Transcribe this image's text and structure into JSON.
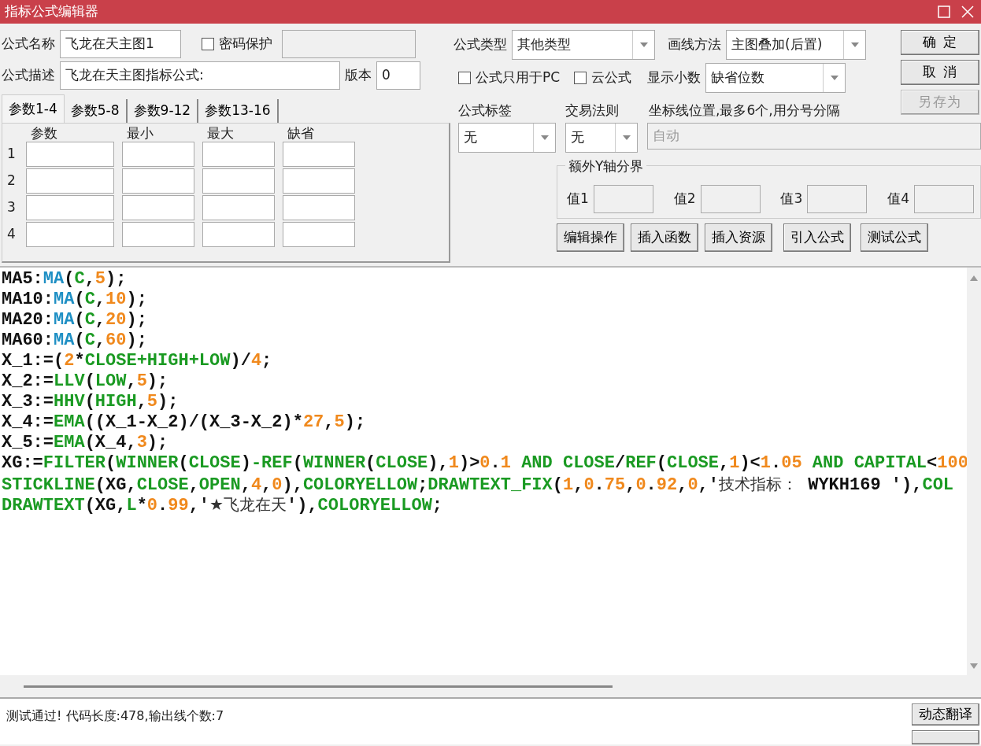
{
  "window": {
    "title": "指标公式编辑器"
  },
  "name_field": {
    "label": "公式名称",
    "value": "飞龙在天主图1"
  },
  "password": {
    "label": "密码保护",
    "checked": false
  },
  "description": {
    "label": "公式描述",
    "value": "飞龙在天主图指标公式:"
  },
  "version": {
    "label": "版本",
    "value": "0"
  },
  "param_tabs": [
    {
      "label": "参数1-4",
      "selected": true
    },
    {
      "label": "参数5-8",
      "selected": false
    },
    {
      "label": "参数9-12",
      "selected": false
    },
    {
      "label": "参数13-16",
      "selected": false
    }
  ],
  "param_columns": [
    "参数",
    "最小",
    "最大",
    "缺省"
  ],
  "param_rows": [
    "1",
    "2",
    "3",
    "4"
  ],
  "formula_type": {
    "label": "公式类型",
    "value": "其他类型"
  },
  "draw_method": {
    "label": "画线方法",
    "value": "主图叠加(后置)"
  },
  "pc_only": {
    "label": "公式只用于PC",
    "checked": false
  },
  "cloud": {
    "label": "云公式",
    "checked": false
  },
  "decimals": {
    "label": "显示小数",
    "value": "缺省位数"
  },
  "action_buttons": [
    {
      "label": "确 定",
      "disabled": false
    },
    {
      "label": "取 消",
      "disabled": false
    },
    {
      "label": "另存为",
      "disabled": true
    }
  ],
  "formula_tag": {
    "label": "公式标签",
    "value": "无"
  },
  "trade_rule": {
    "label": "交易法则",
    "value": "无"
  },
  "axis_lines": {
    "label": "坐标线位置,最多6个,用分号分隔",
    "placeholder": "自动"
  },
  "y_axis": {
    "title": "额外Y轴分界",
    "fields": [
      "值1",
      "值2",
      "值3",
      "值4"
    ]
  },
  "tool_buttons": [
    "编辑操作",
    "插入函数",
    "插入资源",
    "引入公式",
    "测试公式"
  ],
  "code_lines": [
    [
      {
        "kind": "plain",
        "text": "MA5:"
      },
      {
        "kind": "builtin",
        "text": "MA"
      },
      {
        "kind": "plain",
        "text": "("
      },
      {
        "kind": "keyword",
        "text": "C"
      },
      {
        "kind": "plain",
        "text": ","
      },
      {
        "kind": "number",
        "text": "5"
      },
      {
        "kind": "plain",
        "text": ");"
      }
    ],
    [
      {
        "kind": "plain",
        "text": "MA10:"
      },
      {
        "kind": "builtin",
        "text": "MA"
      },
      {
        "kind": "plain",
        "text": "("
      },
      {
        "kind": "keyword",
        "text": "C"
      },
      {
        "kind": "plain",
        "text": ","
      },
      {
        "kind": "number",
        "text": "10"
      },
      {
        "kind": "plain",
        "text": ");"
      }
    ],
    [
      {
        "kind": "plain",
        "text": "MA20:"
      },
      {
        "kind": "builtin",
        "text": "MA"
      },
      {
        "kind": "plain",
        "text": "("
      },
      {
        "kind": "keyword",
        "text": "C"
      },
      {
        "kind": "plain",
        "text": ","
      },
      {
        "kind": "number",
        "text": "20"
      },
      {
        "kind": "plain",
        "text": ");"
      }
    ],
    [
      {
        "kind": "plain",
        "text": "MA60:"
      },
      {
        "kind": "builtin",
        "text": "MA"
      },
      {
        "kind": "plain",
        "text": "("
      },
      {
        "kind": "keyword",
        "text": "C"
      },
      {
        "kind": "plain",
        "text": ","
      },
      {
        "kind": "number",
        "text": "60"
      },
      {
        "kind": "plain",
        "text": ");"
      }
    ],
    [
      {
        "kind": "plain",
        "text": "X_1:=("
      },
      {
        "kind": "number",
        "text": "2"
      },
      {
        "kind": "plain",
        "text": "*"
      },
      {
        "kind": "keyword",
        "text": "CLOSE+HIGH+LOW"
      },
      {
        "kind": "plain",
        "text": ")/"
      },
      {
        "kind": "number",
        "text": "4"
      },
      {
        "kind": "plain",
        "text": ";"
      }
    ],
    [
      {
        "kind": "plain",
        "text": "X_2:="
      },
      {
        "kind": "keyword",
        "text": "LLV"
      },
      {
        "kind": "plain",
        "text": "("
      },
      {
        "kind": "keyword",
        "text": "LOW"
      },
      {
        "kind": "plain",
        "text": ","
      },
      {
        "kind": "number",
        "text": "5"
      },
      {
        "kind": "plain",
        "text": ");"
      }
    ],
    [
      {
        "kind": "plain",
        "text": "X_3:="
      },
      {
        "kind": "keyword",
        "text": "HHV"
      },
      {
        "kind": "plain",
        "text": "("
      },
      {
        "kind": "keyword",
        "text": "HIGH"
      },
      {
        "kind": "plain",
        "text": ","
      },
      {
        "kind": "number",
        "text": "5"
      },
      {
        "kind": "plain",
        "text": ");"
      }
    ],
    [
      {
        "kind": "plain",
        "text": "X_4:="
      },
      {
        "kind": "keyword",
        "text": "EMA"
      },
      {
        "kind": "plain",
        "text": "((X_1-X_2)/(X_3-X_2)*"
      },
      {
        "kind": "number",
        "text": "27"
      },
      {
        "kind": "plain",
        "text": ","
      },
      {
        "kind": "number",
        "text": "5"
      },
      {
        "kind": "plain",
        "text": ");"
      }
    ],
    [
      {
        "kind": "plain",
        "text": "X_5:="
      },
      {
        "kind": "keyword",
        "text": "EMA"
      },
      {
        "kind": "plain",
        "text": "(X_4,"
      },
      {
        "kind": "number",
        "text": "3"
      },
      {
        "kind": "plain",
        "text": ");"
      }
    ],
    [
      {
        "kind": "plain",
        "text": "XG:="
      },
      {
        "kind": "keyword",
        "text": "FILTER"
      },
      {
        "kind": "plain",
        "text": "("
      },
      {
        "kind": "keyword",
        "text": "WINNER"
      },
      {
        "kind": "plain",
        "text": "("
      },
      {
        "kind": "keyword",
        "text": "CLOSE"
      },
      {
        "kind": "plain",
        "text": ")"
      },
      {
        "kind": "keyword",
        "text": "-REF"
      },
      {
        "kind": "plain",
        "text": "("
      },
      {
        "kind": "keyword",
        "text": "WINNER"
      },
      {
        "kind": "plain",
        "text": "("
      },
      {
        "kind": "keyword",
        "text": "CLOSE"
      },
      {
        "kind": "plain",
        "text": "),"
      },
      {
        "kind": "number",
        "text": "1"
      },
      {
        "kind": "plain",
        "text": ")>"
      },
      {
        "kind": "number",
        "text": "0"
      },
      {
        "kind": "plain",
        "text": "."
      },
      {
        "kind": "number",
        "text": "1"
      },
      {
        "kind": "keyword",
        "text": " AND CLOSE"
      },
      {
        "kind": "plain",
        "text": "/"
      },
      {
        "kind": "keyword",
        "text": "REF"
      },
      {
        "kind": "plain",
        "text": "("
      },
      {
        "kind": "keyword",
        "text": "CLOSE"
      },
      {
        "kind": "plain",
        "text": ","
      },
      {
        "kind": "number",
        "text": "1"
      },
      {
        "kind": "plain",
        "text": ")<"
      },
      {
        "kind": "number",
        "text": "1"
      },
      {
        "kind": "plain",
        "text": "."
      },
      {
        "kind": "number",
        "text": "05"
      },
      {
        "kind": "keyword",
        "text": " AND CAPITAL"
      },
      {
        "kind": "plain",
        "text": "<"
      },
      {
        "kind": "number",
        "text": "100"
      }
    ],
    [
      {
        "kind": "keyword",
        "text": "STICKLINE"
      },
      {
        "kind": "plain",
        "text": "(XG,"
      },
      {
        "kind": "keyword",
        "text": "CLOSE"
      },
      {
        "kind": "plain",
        "text": ","
      },
      {
        "kind": "keyword",
        "text": "OPEN"
      },
      {
        "kind": "plain",
        "text": ","
      },
      {
        "kind": "number",
        "text": "4"
      },
      {
        "kind": "plain",
        "text": ","
      },
      {
        "kind": "number",
        "text": "0"
      },
      {
        "kind": "plain",
        "text": "),"
      },
      {
        "kind": "keyword",
        "text": "COLORYELLOW"
      },
      {
        "kind": "plain",
        "text": ";"
      },
      {
        "kind": "keyword",
        "text": "DRAWTEXT_FIX"
      },
      {
        "kind": "plain",
        "text": "("
      },
      {
        "kind": "number",
        "text": "1"
      },
      {
        "kind": "plain",
        "text": ","
      },
      {
        "kind": "number",
        "text": "0"
      },
      {
        "kind": "plain",
        "text": "."
      },
      {
        "kind": "number",
        "text": "75"
      },
      {
        "kind": "plain",
        "text": ","
      },
      {
        "kind": "number",
        "text": "0"
      },
      {
        "kind": "plain",
        "text": "."
      },
      {
        "kind": "number",
        "text": "92"
      },
      {
        "kind": "plain",
        "text": ","
      },
      {
        "kind": "number",
        "text": "0"
      },
      {
        "kind": "plain",
        "text": ",'"
      },
      {
        "kind": "text",
        "text": "技术指标："
      },
      {
        "kind": "plain",
        "text": " WYKH169 '),"
      },
      {
        "kind": "keyword",
        "text": "COL"
      }
    ],
    [
      {
        "kind": "keyword",
        "text": "DRAWTEXT"
      },
      {
        "kind": "plain",
        "text": "(XG,"
      },
      {
        "kind": "keyword",
        "text": "L"
      },
      {
        "kind": "plain",
        "text": "*"
      },
      {
        "kind": "number",
        "text": "0"
      },
      {
        "kind": "plain",
        "text": "."
      },
      {
        "kind": "number",
        "text": "99"
      },
      {
        "kind": "plain",
        "text": ",'"
      },
      {
        "kind": "text",
        "text": "★飞龙在天"
      },
      {
        "kind": "plain",
        "text": "'),"
      },
      {
        "kind": "keyword",
        "text": "COLORYELLOW"
      },
      {
        "kind": "plain",
        "text": ";"
      }
    ]
  ],
  "status": {
    "message": "测试通过! 代码长度:478,输出线个数:7"
  },
  "translate_button": {
    "label": "动态翻译"
  }
}
